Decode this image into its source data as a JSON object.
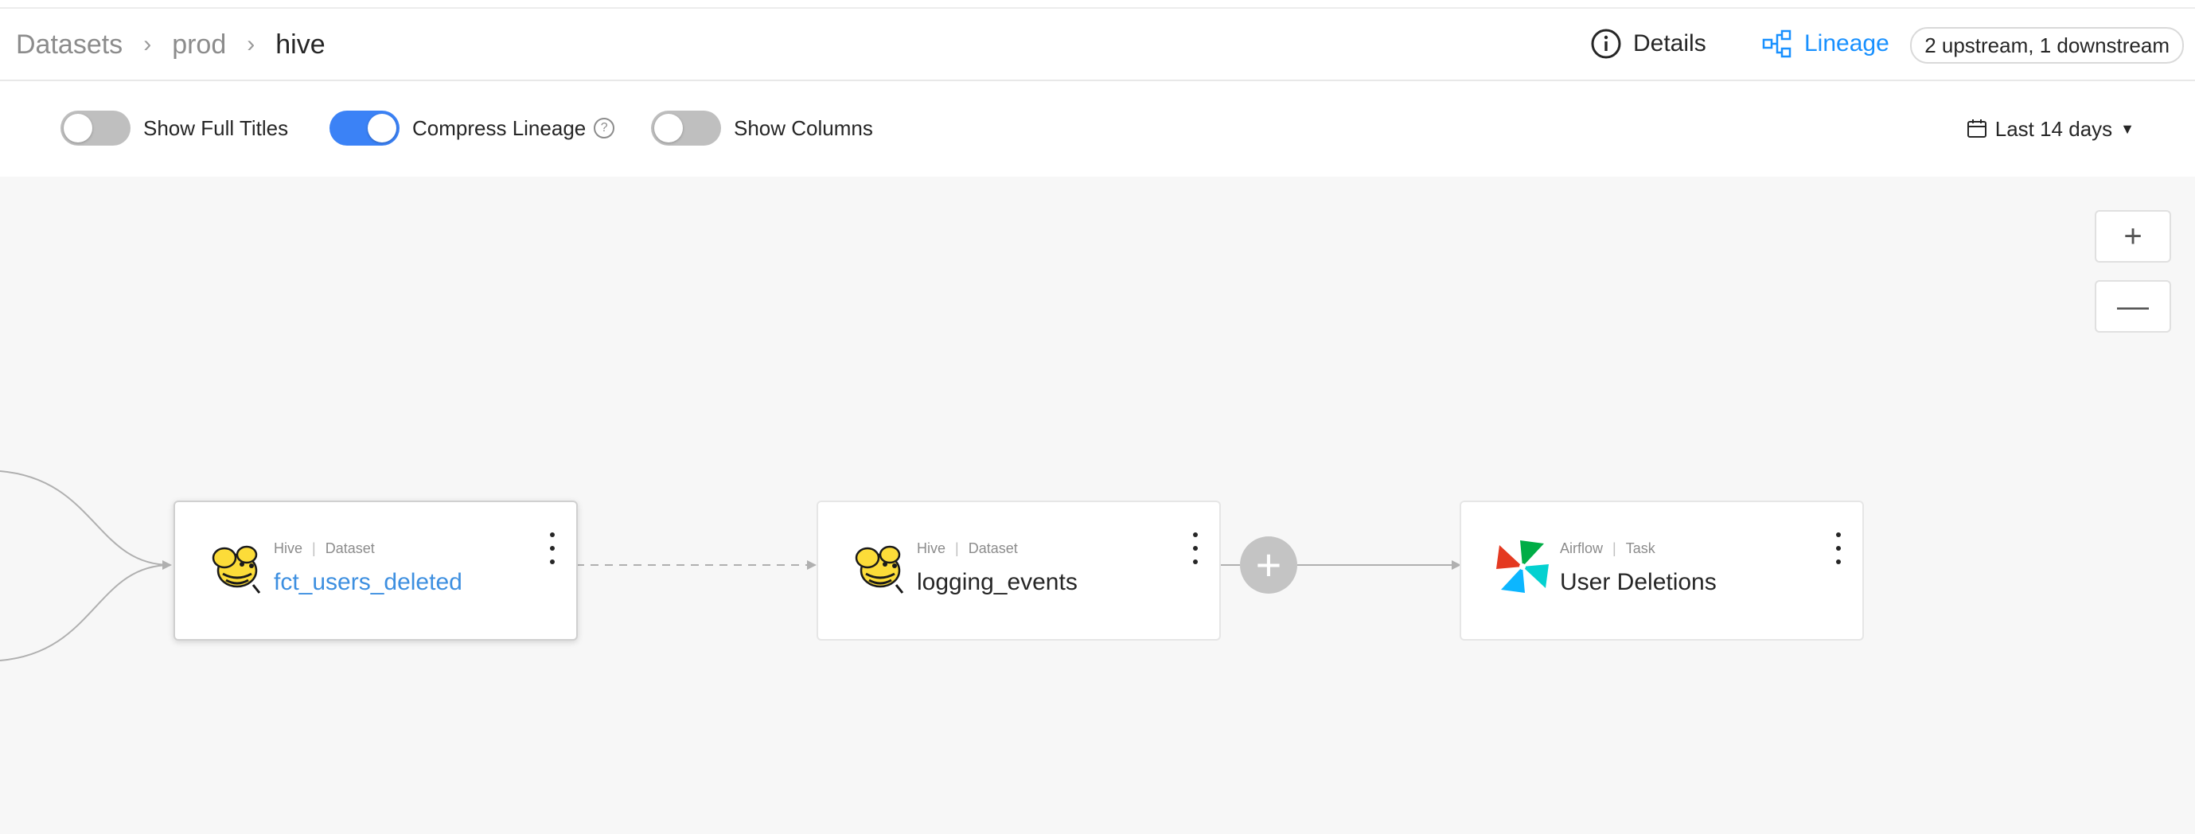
{
  "breadcrumb": [
    "Datasets",
    "prod",
    "hive"
  ],
  "header": {
    "details_label": "Details",
    "lineage_label": "Lineage",
    "lineage_count": "2 upstream, 1 downstream"
  },
  "toolbar": {
    "show_full_titles": {
      "label": "Show Full Titles",
      "enabled": false
    },
    "compress_lineage": {
      "label": "Compress Lineage",
      "enabled": true
    },
    "show_columns": {
      "label": "Show Columns",
      "enabled": false
    },
    "date_range": "Last 14 days"
  },
  "zoom": {
    "in": "+",
    "out": "—"
  },
  "nodes": [
    {
      "platform": "Hive",
      "type": "Dataset",
      "name": "fct_users_deleted",
      "selected": true,
      "logo": "hive-logo"
    },
    {
      "platform": "Hive",
      "type": "Dataset",
      "name": "logging_events",
      "selected": false,
      "logo": "hive-logo"
    },
    {
      "platform": "Airflow",
      "type": "Task",
      "name": "User Deletions",
      "selected": false,
      "logo": "airflow-logo"
    }
  ],
  "expand_label": "+",
  "colors": {
    "accent": "#1890ff",
    "toggle_on": "#3b82f6",
    "toggle_off": "#bfbfbf",
    "selected_title": "#3d8fe0"
  }
}
